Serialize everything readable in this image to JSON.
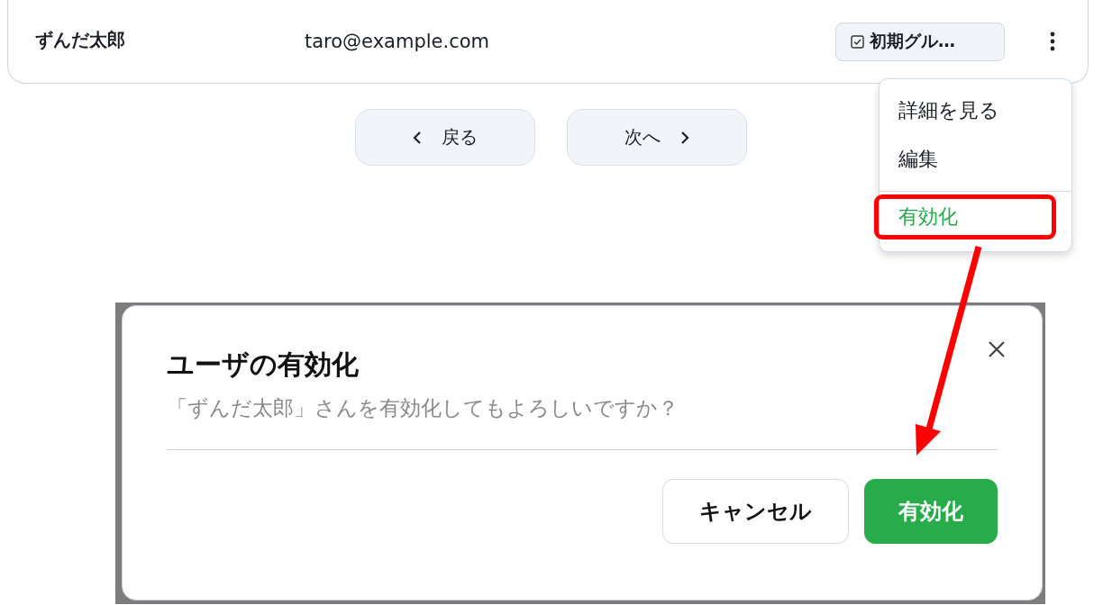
{
  "user_row": {
    "name": "ずんだ太郎",
    "email": "taro@example.com",
    "group_tag": "初期グル…"
  },
  "pagination": {
    "prev": "戻る",
    "next": "次へ"
  },
  "row_menu": {
    "items": [
      {
        "label": "詳細を見る",
        "kind": "normal",
        "annotated": false
      },
      {
        "label": "編集",
        "kind": "normal",
        "annotated": false
      },
      {
        "label": "有効化",
        "kind": "success",
        "annotated": true
      }
    ]
  },
  "dialog": {
    "title": "ユーザの有効化",
    "message": "「ずんだ太郎」さんを有効化してもよろしいですか？",
    "buttons": [
      {
        "label": "キャンセル",
        "kind": "secondary"
      },
      {
        "label": "有効化",
        "kind": "primary"
      }
    ]
  }
}
